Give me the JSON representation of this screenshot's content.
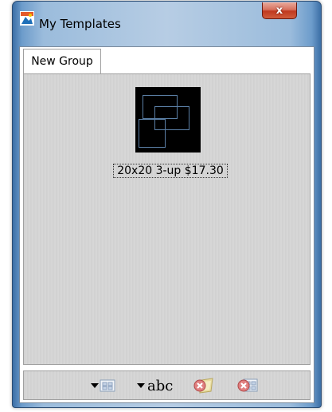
{
  "window": {
    "title": "My Templates",
    "close_label": "x"
  },
  "tabs": [
    {
      "label": "New Group"
    }
  ],
  "templates": [
    {
      "name": "20x20 3-up $17.30"
    }
  ],
  "toolbar": {
    "buttons": [
      {
        "name": "add-template-button",
        "icon": "add-template-dropdown-icon"
      },
      {
        "name": "rename-button",
        "icon": "text-abc-icon",
        "text": "abc"
      },
      {
        "name": "delete-group-button",
        "icon": "delete-group-icon"
      },
      {
        "name": "delete-template-button",
        "icon": "delete-template-icon"
      }
    ]
  }
}
